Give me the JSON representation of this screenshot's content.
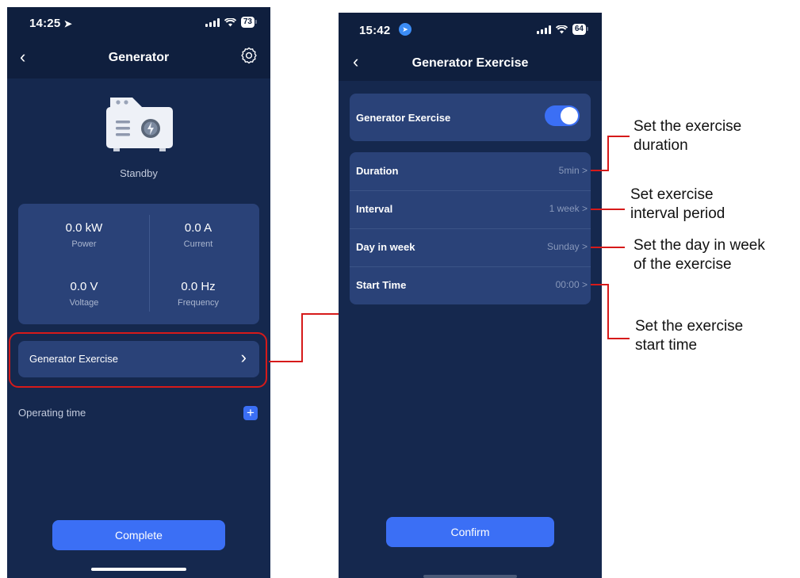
{
  "phone1": {
    "status_time": "14:25",
    "battery": "73",
    "nav_title": "Generator",
    "status_label": "Standby",
    "stats": [
      {
        "value": "0.0 kW",
        "label": "Power"
      },
      {
        "value": "0.0 A",
        "label": "Current"
      },
      {
        "value": "0.0 V",
        "label": "Voltage"
      },
      {
        "value": "0.0 Hz",
        "label": "Frequency"
      }
    ],
    "exercise_label": "Generator Exercise",
    "operating_time_label": "Operating time",
    "complete_label": "Complete"
  },
  "phone2": {
    "status_time": "15:42",
    "battery": "64",
    "nav_title": "Generator Exercise",
    "toggle_label": "Generator Exercise",
    "toggle_on": true,
    "rows": [
      {
        "label": "Duration",
        "value": "5min >"
      },
      {
        "label": "Interval",
        "value": "1 week >"
      },
      {
        "label": "Day in week",
        "value": "Sunday >"
      },
      {
        "label": "Start Time",
        "value": "00:00 >"
      }
    ],
    "confirm_label": "Confirm"
  },
  "callouts": [
    "Set the exercise\nduration",
    "Set exercise\ninterval period",
    "Set the day in week\nof the exercise",
    "Set the exercise\nstart time"
  ],
  "colors": {
    "screen_bg": "#15284e",
    "panel_bg": "#2a4278",
    "accent": "#3b6ff5",
    "highlight_red": "#d61a1a"
  }
}
